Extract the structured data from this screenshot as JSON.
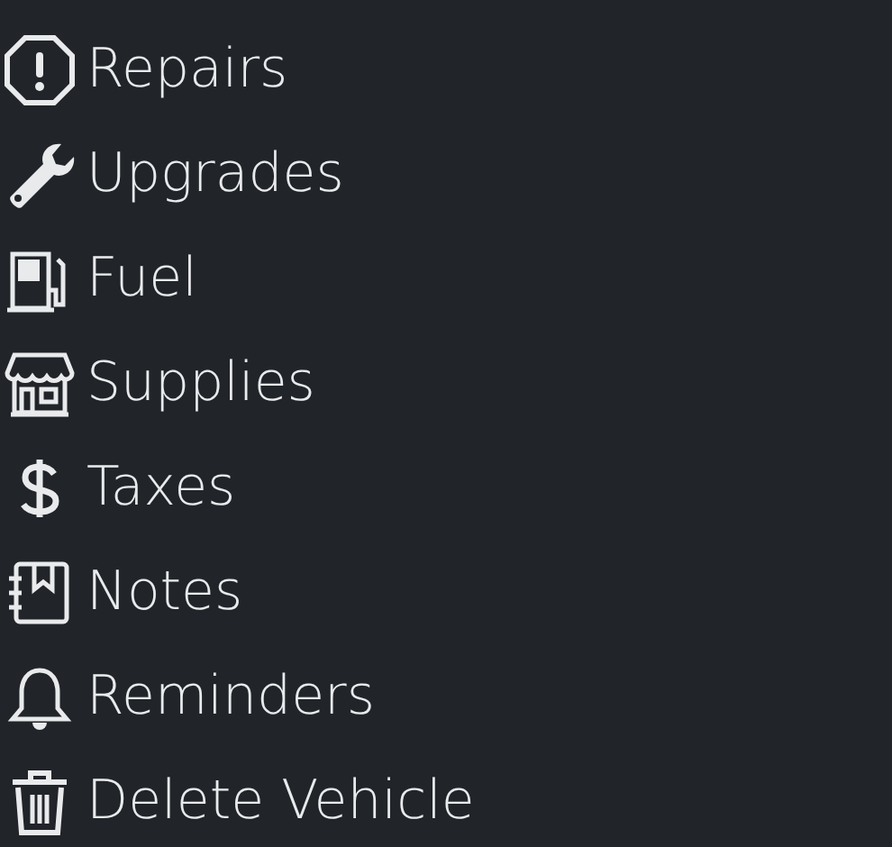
{
  "menu": {
    "items": [
      {
        "label": "Repairs"
      },
      {
        "label": "Upgrades"
      },
      {
        "label": "Fuel"
      },
      {
        "label": "Supplies"
      },
      {
        "label": "Taxes"
      },
      {
        "label": "Notes"
      },
      {
        "label": "Reminders"
      },
      {
        "label": "Delete Vehicle"
      }
    ]
  }
}
